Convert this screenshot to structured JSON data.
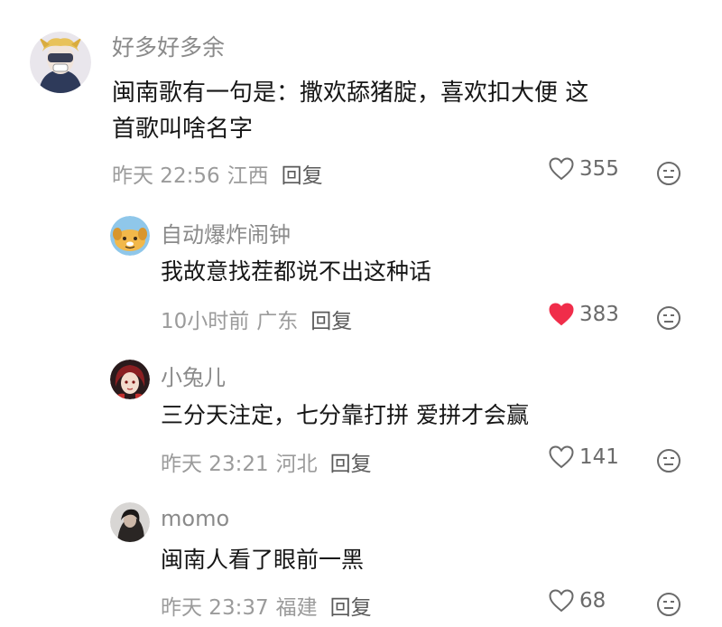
{
  "comments": [
    {
      "username": "好多好多余",
      "content_lines": [
        "闽南歌有一句是：撒欢舔猪腚，喜欢扣大便  这",
        "首歌叫啥名字"
      ],
      "time": "昨天 22:56",
      "region": "江西",
      "reply_label": "回复",
      "likes": "355",
      "liked": false,
      "avatar": "avatar-masked-character"
    },
    {
      "username": "自动爆炸闹钟",
      "content": "我故意找茬都说不出这种话",
      "time": "10小时前",
      "region": "广东",
      "reply_label": "回复",
      "likes": "383",
      "liked": true,
      "avatar": "avatar-cartoon-dog"
    },
    {
      "username": "小兔儿",
      "content": "三分天注定，七分靠打拼  爱拼才会赢",
      "time": "昨天 23:21",
      "region": "河北",
      "reply_label": "回复",
      "likes": "141",
      "liked": false,
      "avatar": "avatar-red-haired-character"
    },
    {
      "username": "momo",
      "content": "闽南人看了眼前一黑",
      "time": "昨天 23:37",
      "region": "福建",
      "reply_label": "回复",
      "likes": "68",
      "liked": false,
      "avatar": "avatar-dark-photo"
    }
  ],
  "colors": {
    "username": "#8a8a8a",
    "content": "#161616",
    "meta": "#9b9b9b",
    "reply": "#5a5a5a",
    "liked_heart": "#f02d4a",
    "heart_outline": "#6a6a6a"
  },
  "icons": [
    "heart-outline-icon",
    "heart-filled-icon",
    "dislike-face-icon"
  ]
}
